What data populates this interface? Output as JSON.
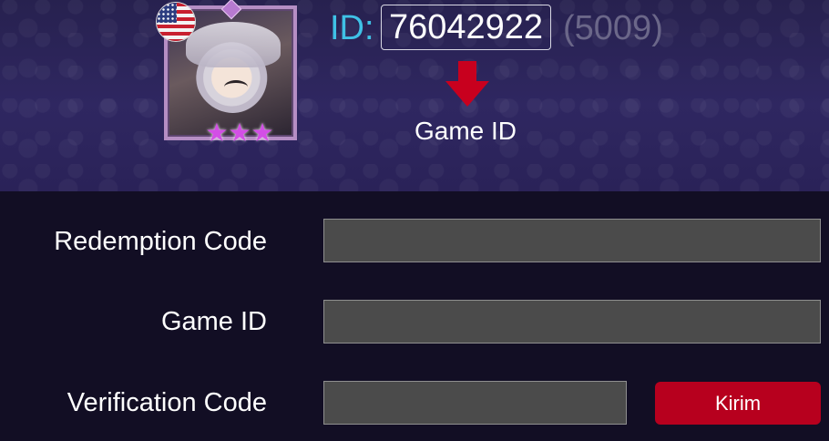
{
  "header": {
    "id_label": "ID:",
    "id_value": "76042922",
    "server": "(5009)",
    "arrow_caption": "Game ID",
    "flag_icon": "us-flag-icon",
    "arrow_icon": "down-arrow-icon",
    "arrow_color": "#c8001e",
    "id_label_color": "#3fc1e6",
    "stars_count": 3
  },
  "form": {
    "redemption_label": "Redemption Code",
    "redemption_value": "",
    "game_id_label": "Game ID",
    "game_id_value": "",
    "verification_label": "Verification Code",
    "verification_value": "",
    "submit_label": "Kirim",
    "submit_color": "#b7001e"
  }
}
